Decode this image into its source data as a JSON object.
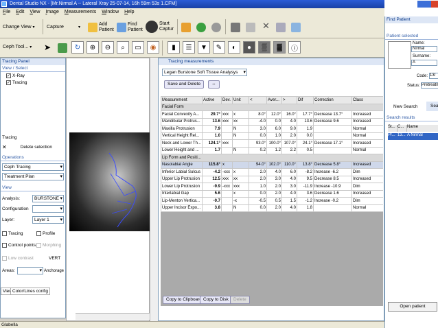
{
  "window": {
    "title": "Dental Studio NX - [Mr.Nirmal A -- Lateral Xray 25-07-14, 16h 59m 53s 1.CFM]"
  },
  "menu": [
    "File",
    "Edit",
    "View",
    "Image",
    "Measurements",
    "Window",
    "Help"
  ],
  "toolbar": {
    "change_view": "Change View",
    "capture": "Capture",
    "add_patient_1": "Add",
    "add_patient_2": "Patient",
    "find_patient_1": "Find",
    "find_patient_2": "Patient",
    "start_capture_1": "Start",
    "start_capture_2": "Captur",
    "ceph_tool": "Ceph Tool..."
  },
  "tracing_panel": {
    "title": "Tracing Panel",
    "view_select": "View / Select",
    "layers": [
      "X-Ray",
      "Tracing"
    ],
    "tracing_label": "Tracing",
    "delete_selection": "Delete selection",
    "operations": "Operations",
    "op_items": [
      "Ceph Tracing",
      "Treatment Plan"
    ],
    "view": "View",
    "analysis_label": "Analysis:",
    "analysis_value": "BURSTONE",
    "configuration_label": "Configuration",
    "layer_label": "Layer:",
    "layer_value": "Layer 1",
    "checks": [
      "Tracing",
      "Profile",
      "Control points",
      "Morphing",
      "Low contrast"
    ],
    "vert": "VERT",
    "areas_label": "Areas:",
    "anchorage": "Anchorage",
    "tabs": [
      "View",
      "Color/Lines config"
    ]
  },
  "measurements": {
    "title": "Tracing measurements",
    "analysis": "Legan Burstone Soft Tissue Analysys",
    "save_delete": "Save and Delete",
    "headers": [
      "Measurement",
      "Active",
      "Dev.",
      "Unit",
      "<",
      "Aver...",
      ">",
      "Dif",
      "Correction",
      "Class"
    ],
    "rows": [
      {
        "group": "Facial Form"
      },
      {
        "m": "Facial Convexity A...",
        "a": "29.7°",
        "d": "xxx",
        "u": "x",
        "lt": "8.0°",
        "av": "12.0°",
        "gt": "16.0°",
        "df": "17.7°",
        "c": "Decrease 13.7°",
        "cl": "Increased"
      },
      {
        "m": "Mandibular Protrus...",
        "a": "13.6",
        "d": "xxx",
        "u": "xx",
        "lt": "-4.0",
        "av": "0.0",
        "gt": "4.0",
        "df": "13.6",
        "c": "Decrease 9.6",
        "cl": "Increased"
      },
      {
        "m": "Maxilla Protrusion",
        "a": "7.9",
        "d": "",
        "u": "N",
        "lt": "3.0",
        "av": "6.0",
        "gt": "9.0",
        "df": "1.9",
        "c": "",
        "cl": "Normal"
      },
      {
        "m": "Vertical Height Rel...",
        "a": "1.0",
        "d": "",
        "u": "N",
        "lt": "0.0",
        "av": "1.0",
        "gt": "2.0",
        "df": "0.0",
        "c": "",
        "cl": "Normal"
      },
      {
        "m": "Neck and Lower Th...",
        "a": "124.1°",
        "d": "xxx",
        "u": "",
        "lt": "93.0°",
        "av": "100.0°",
        "gt": "107.0°",
        "df": "24.1°",
        "c": "Decrease 17.1°",
        "cl": "Increased"
      },
      {
        "m": "Lower Height and ...",
        "a": "1.7",
        "d": "",
        "u": "N",
        "lt": "0.2",
        "av": "1.2",
        "gt": "2.2",
        "df": "0.5",
        "c": "",
        "cl": "Normal"
      },
      {
        "group": "Lip Form and Positi..."
      },
      {
        "m": "Nasolabial Angle",
        "a": "115.8°",
        "d": "x",
        "u": "",
        "lt": "94.0°",
        "av": "102.0°",
        "gt": "110.0°",
        "df": "13.8°",
        "c": "Decrease 5.8°",
        "cl": "Increased",
        "hi": true
      },
      {
        "m": "Inferior Labial Sulcus",
        "a": "-4.2",
        "d": "-xxx",
        "u": "x",
        "lt": "2.0",
        "av": "4.0",
        "gt": "6.0",
        "df": "-8.2",
        "c": "Increase -6.2",
        "cl": "Dim"
      },
      {
        "m": "Upper Lip Protrusion",
        "a": "12.5",
        "d": "xxx",
        "u": "xx",
        "lt": "2.0",
        "av": "3.0",
        "gt": "4.0",
        "df": "9.5",
        "c": "Decrease 8.5",
        "cl": "Increased"
      },
      {
        "m": "Lower Lip Protrusion",
        "a": "-9.9",
        "d": "-xxx",
        "u": "xxx",
        "lt": "1.0",
        "av": "2.0",
        "gt": "3.0",
        "df": "-11.9",
        "c": "Increase -10.9",
        "cl": "Dim"
      },
      {
        "m": "Interlabial Gap",
        "a": "5.6",
        "d": "",
        "u": "x",
        "lt": "0.0",
        "av": "2.0",
        "gt": "4.0",
        "df": "3.6",
        "c": "Decrease 1.6",
        "cl": "Increased"
      },
      {
        "m": "Lip-Menton Vertica...",
        "a": "-0.7",
        "d": "",
        "u": "-x",
        "lt": "-0.5",
        "av": "0.5",
        "gt": "1.5",
        "df": "-1.2",
        "c": "Increase -0.2",
        "cl": "Dim"
      },
      {
        "m": "Upper Incisor Expo...",
        "a": "3.8",
        "d": "",
        "u": "N",
        "lt": "0.0",
        "av": "2.0",
        "gt": "4.0",
        "df": "1.8",
        "c": "",
        "cl": "Normal"
      }
    ],
    "copy_clipboard": "Copy to Clipboard",
    "copy_disk": "Copy to Disk",
    "delete": "Delete"
  },
  "find_patient": {
    "title": "Find Patient",
    "patient_selected": "Patient selected",
    "name_label": "Name:",
    "name_value": "Nirmal",
    "surname_label": "Surname:",
    "surname_value": "A",
    "code_label": "Code:",
    "code_value": "13/",
    "status_label": "Status:",
    "status_value": "Pretreatme",
    "new_search": "New Search",
    "search": "Sea",
    "search_results": "Search results",
    "cols": [
      "St...",
      "C...",
      "Name"
    ],
    "result": [
      "Pr...",
      "13...",
      "A Nirmal"
    ],
    "open_patient": "Open patient"
  },
  "statusbar": {
    "text": "Glabella"
  }
}
